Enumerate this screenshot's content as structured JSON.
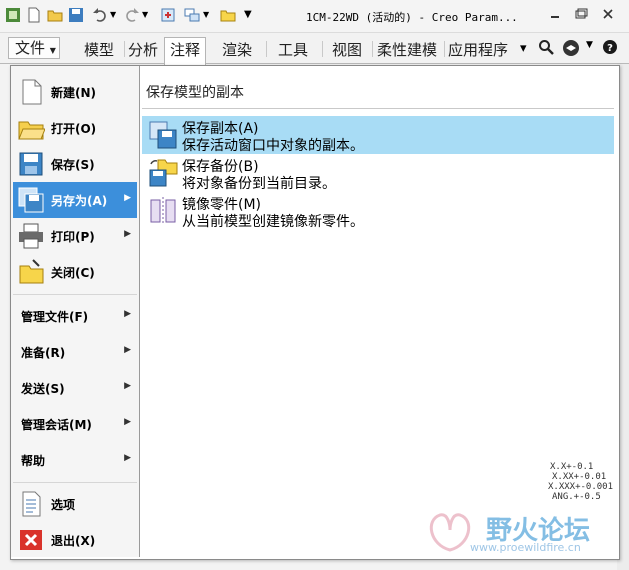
{
  "window": {
    "title": "1CM-22WD (活动的) - Creo Param...",
    "quick_access_icons": [
      "app-icon",
      "new-icon",
      "open-icon",
      "save-icon",
      "undo-icon",
      "dropdown-icon",
      "redo-icon",
      "dropdown-icon",
      "regenerate-icon",
      "windows-icon",
      "dropdown-icon",
      "folder-icon",
      "customize-icon"
    ],
    "controls": [
      "minimize-icon",
      "restore-icon",
      "close-icon"
    ]
  },
  "ribbon": {
    "file_tab": "文件",
    "tabs": [
      "模型",
      "分析",
      "注释",
      "渲染",
      "工具",
      "视图",
      "柔性建模",
      "应用程序"
    ],
    "active_tab": "注释"
  },
  "file_menu": {
    "items": [
      {
        "label": "新建",
        "key": "N",
        "display": "新建(N)",
        "icon": "new-document-icon",
        "submenu": false,
        "highlighted": false
      },
      {
        "label": "打开",
        "key": "O",
        "display": "打开(O)",
        "icon": "open-folder-icon",
        "submenu": false,
        "highlighted": false
      },
      {
        "label": "保存",
        "key": "S",
        "display": "保存(S)",
        "icon": "save-disk-icon",
        "submenu": false,
        "highlighted": false
      },
      {
        "label": "另存为",
        "key": "A",
        "display": "另存为(A)",
        "icon": "save-as-icon",
        "submenu": true,
        "highlighted": true
      },
      {
        "label": "打印",
        "key": "P",
        "display": "打印(P)",
        "icon": "printer-icon",
        "submenu": true,
        "highlighted": false
      },
      {
        "label": "关闭",
        "key": "C",
        "display": "关闭(C)",
        "icon": "close-folder-icon",
        "submenu": false,
        "highlighted": false
      }
    ],
    "text_items": [
      {
        "display": "管理文件(F)",
        "submenu": true
      },
      {
        "display": "准备(R)",
        "submenu": true
      },
      {
        "display": "发送(S)",
        "submenu": true
      },
      {
        "display": "管理会话(M)",
        "submenu": true
      },
      {
        "display": "帮助",
        "submenu": true
      }
    ],
    "bottom_items": [
      {
        "display": "选项",
        "icon": "options-icon"
      },
      {
        "display": "退出(X)",
        "icon": "exit-icon"
      }
    ]
  },
  "submenu": {
    "heading": "保存模型的副本",
    "items": [
      {
        "title": "保存副本(A)",
        "desc": "保存活动窗口中对象的副本。",
        "icon": "save-copy-icon",
        "highlighted": true
      },
      {
        "title": "保存备份(B)",
        "desc": "将对象备份到当前目录。",
        "icon": "save-backup-icon",
        "highlighted": false
      },
      {
        "title": "镜像零件(M)",
        "desc": "从当前模型创建镜像新零件。",
        "icon": "mirror-part-icon",
        "highlighted": false
      }
    ]
  },
  "tolerances": [
    "X.X+-0.1",
    "X.XX+-0.01",
    "X.XXX+-0.001",
    "ANG.+-0.5"
  ],
  "watermark": {
    "text": "野火论坛",
    "url": "www.proewildfire.cn"
  },
  "colors": {
    "highlight": "#3c8fdb",
    "sub_highlight": "#a8dcf5",
    "menu_bg": "#f5f5f5"
  }
}
